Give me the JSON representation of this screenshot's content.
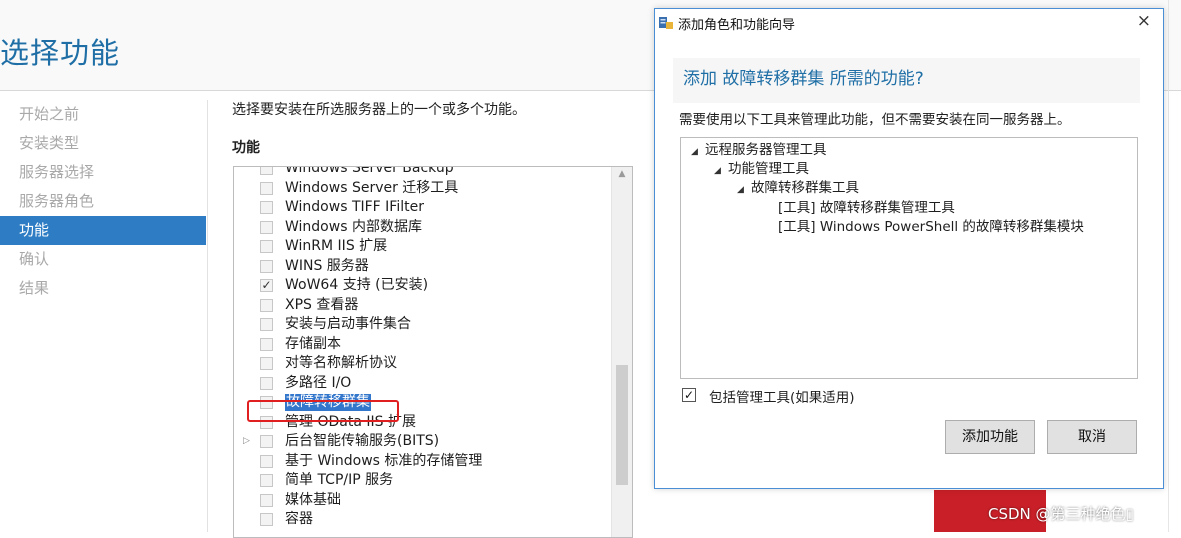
{
  "page": {
    "title": "选择功能",
    "intro": "选择要安装在所选服务器上的一个或多个功能。",
    "features_heading": "功能"
  },
  "nav": {
    "items": [
      {
        "label": "开始之前",
        "active": false
      },
      {
        "label": "安装类型",
        "active": false
      },
      {
        "label": "服务器选择",
        "active": false
      },
      {
        "label": "服务器角色",
        "active": false
      },
      {
        "label": "功能",
        "active": true
      },
      {
        "label": "确认",
        "active": false
      },
      {
        "label": "结果",
        "active": false
      }
    ]
  },
  "features": [
    {
      "label": "Windows Server Backup",
      "checked": false
    },
    {
      "label": "Windows Server 迁移工具",
      "checked": false
    },
    {
      "label": "Windows TIFF IFilter",
      "checked": false
    },
    {
      "label": "Windows 内部数据库",
      "checked": false
    },
    {
      "label": "WinRM IIS 扩展",
      "checked": false
    },
    {
      "label": "WINS 服务器",
      "checked": false
    },
    {
      "label": "WoW64 支持 (已安装)",
      "checked": true
    },
    {
      "label": "XPS 查看器",
      "checked": false
    },
    {
      "label": "安装与启动事件集合",
      "checked": false
    },
    {
      "label": "存储副本",
      "checked": false
    },
    {
      "label": "对等名称解析协议",
      "checked": false
    },
    {
      "label": "多路径 I/O",
      "checked": false
    },
    {
      "label": "故障转移群集",
      "checked": false,
      "selected": true
    },
    {
      "label": "管理 OData IIS 扩展",
      "checked": false
    },
    {
      "label": "后台智能传输服务(BITS)",
      "checked": false,
      "expandable": true
    },
    {
      "label": "基于 Windows 标准的存储管理",
      "checked": false
    },
    {
      "label": "简单 TCP/IP 服务",
      "checked": false
    },
    {
      "label": "媒体基础",
      "checked": false
    },
    {
      "label": "容器",
      "checked": false
    }
  ],
  "dialog": {
    "title": "添加角色和功能向导",
    "close_symbol": "×",
    "heading": "添加 故障转移群集 所需的功能?",
    "description": "需要使用以下工具来管理此功能，但不需要安装在同一服务器上。",
    "tree": [
      {
        "label": "远程服务器管理工具",
        "level": 0,
        "expanded": true
      },
      {
        "label": "功能管理工具",
        "level": 1,
        "expanded": true
      },
      {
        "label": "故障转移群集工具",
        "level": 2,
        "expanded": true
      },
      {
        "label": "[工具] 故障转移群集管理工具",
        "level": 3
      },
      {
        "label": "[工具] Windows PowerShell 的故障转移群集模块",
        "level": 3
      }
    ],
    "include_tools_label": "包括管理工具(如果适用)",
    "include_tools_checked": true,
    "add_button": "添加功能",
    "cancel_button": "取消"
  },
  "watermark": "CSDN @第三种绝色▯",
  "colors": {
    "accent": "#2d7cc4",
    "title_blue": "#1f6fa6",
    "highlight_red": "#e02020",
    "strip_red": "#c91f28"
  }
}
